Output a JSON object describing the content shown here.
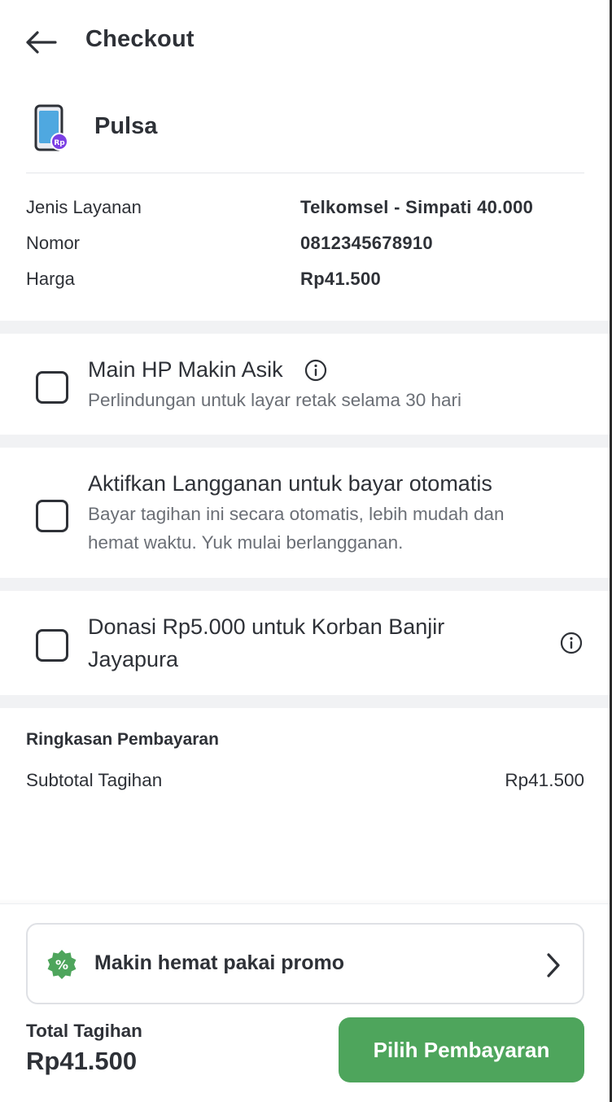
{
  "header": {
    "title": "Checkout"
  },
  "product": {
    "name": "Pulsa",
    "icon": "phone-rp-icon",
    "badge_text": "Rp"
  },
  "details": [
    {
      "label": "Jenis Layanan",
      "value": "Telkomsel - Simpati 40.000"
    },
    {
      "label": "Nomor",
      "value": "0812345678910"
    },
    {
      "label": "Harga",
      "value": "Rp41.500"
    }
  ],
  "options": [
    {
      "title": "Main HP Makin Asik",
      "desc": "Perlindungan untuk layar retak selama 30 hari",
      "checked": false
    },
    {
      "title": "Aktifkan Langganan untuk bayar otomatis",
      "desc_line1": "Bayar tagihan ini secara otomatis, lebih mudah dan",
      "desc_line2": "hemat waktu. Yuk mulai berlangganan.",
      "checked": false
    },
    {
      "title_line1": "Donasi Rp5.000 untuk Korban Banjir",
      "title_line2": "Jayapura",
      "checked": false
    }
  ],
  "summary": {
    "title": "Ringkasan Pembayaran",
    "subtotal_label": "Subtotal Tagihan",
    "subtotal_value": "Rp41.500"
  },
  "footer": {
    "promo_text": "Makin hemat pakai promo",
    "promo_icon_symbol": "%",
    "total_label": "Total Tagihan",
    "total_value": "Rp41.500",
    "pay_button": "Pilih Pembayaran"
  },
  "colors": {
    "primary": "#4ea55c",
    "text": "#2e3137",
    "muted": "#6b6f76",
    "badge": "#7b3fe4"
  }
}
